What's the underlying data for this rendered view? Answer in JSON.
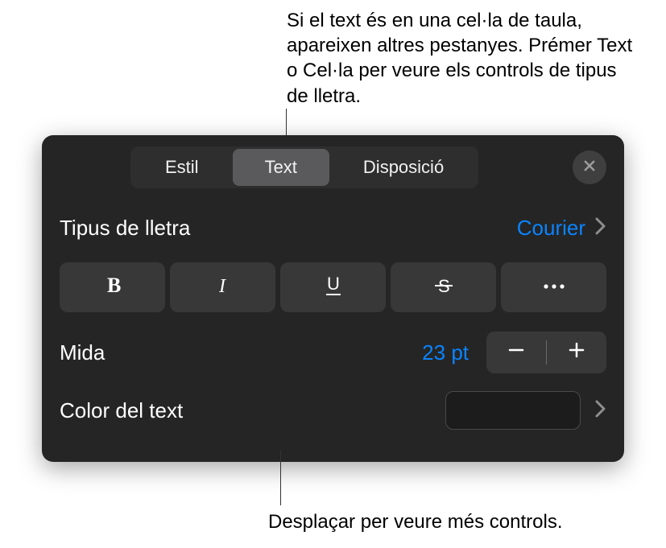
{
  "callouts": {
    "top": "Si el text és en una cel·la de taula, apareixen altres pestanyes. Prémer Text o Cel·la per veure els controls de tipus de lletra.",
    "bottom": "Desplaçar per veure més controls."
  },
  "tabs": {
    "style": "Estil",
    "text": "Text",
    "layout": "Disposició"
  },
  "font": {
    "label": "Tipus de lletra",
    "value": "Courier"
  },
  "size": {
    "label": "Mida",
    "value": "23 pt"
  },
  "textColor": {
    "label": "Color del text",
    "swatch": "#1c1c1c"
  }
}
